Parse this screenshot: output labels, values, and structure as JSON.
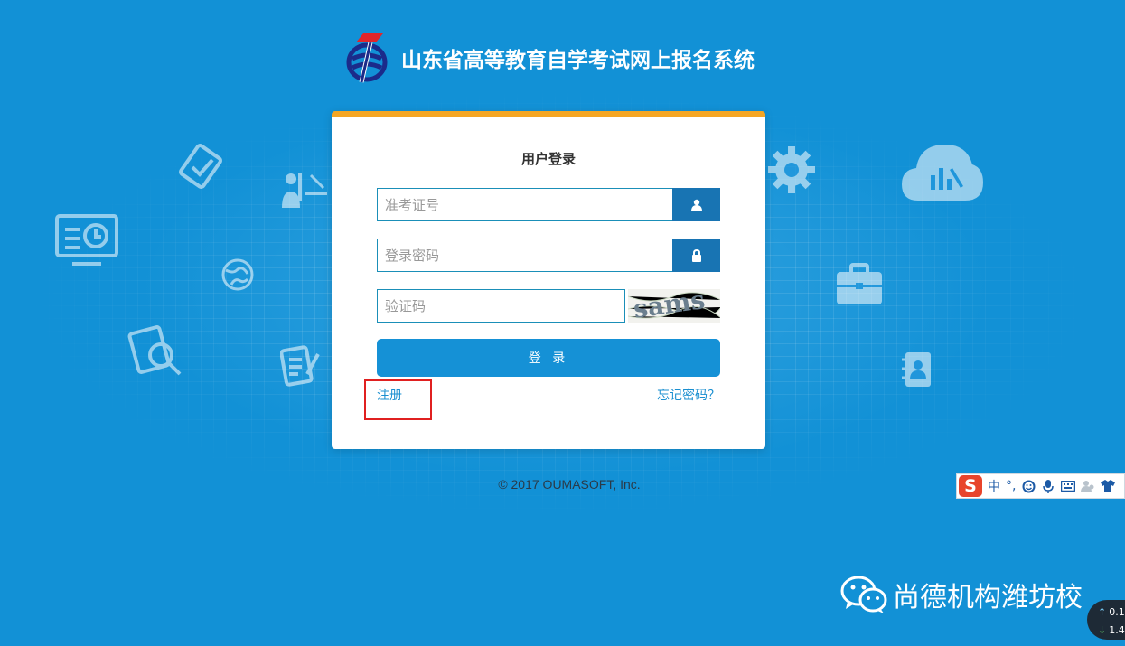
{
  "header": {
    "site_title": "山东省高等教育自学考试网上报名系统",
    "logo_icon": "exam-logo-icon"
  },
  "login": {
    "title": "用户登录",
    "exam_id_placeholder": "准考证号",
    "password_placeholder": "登录密码",
    "captcha_placeholder": "验证码",
    "captcha_text": "sams",
    "login_button": "登 录",
    "register_link": "注册",
    "forgot_link": "忘记密码？",
    "user_icon": "user-icon",
    "lock_icon": "lock-icon"
  },
  "footer": {
    "copyright": "© 2017 OUMASOFT, Inc."
  },
  "ime": {
    "logo": "S",
    "mode": "中",
    "punct": "°,"
  },
  "watermark": {
    "text": "尚德机构潍坊校"
  },
  "speed": {
    "up": "0.1",
    "down": "1.4"
  },
  "colors": {
    "background": "#1291d6",
    "accent": "#f5a623",
    "button": "#1591d6",
    "addon": "#1874b3",
    "highlight": "#e02020"
  }
}
